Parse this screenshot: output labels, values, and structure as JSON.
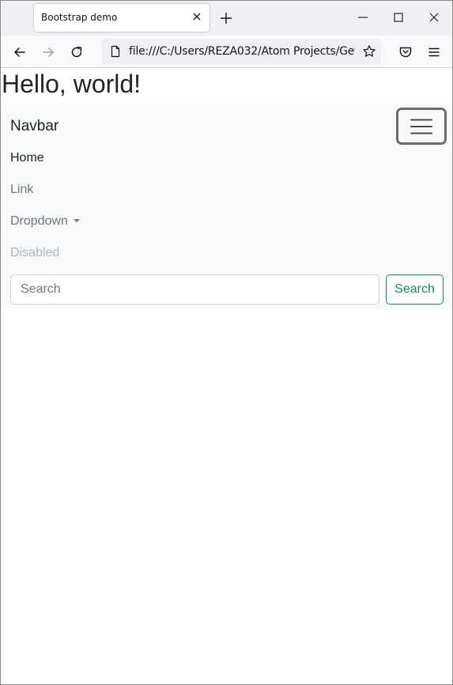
{
  "browser": {
    "tab_title": "Bootstrap demo",
    "url": "file:///C:/Users/REZA032/Atom Projects/Getting",
    "icons": {
      "tab_close": "close-icon",
      "new_tab": "plus-icon",
      "minimize": "minimize-icon",
      "maximize": "maximize-icon",
      "close_window": "close-icon",
      "back": "arrow-left-icon",
      "forward": "arrow-right-icon",
      "reload": "reload-icon",
      "page": "page-icon",
      "bookmark": "star-icon",
      "pocket": "pocket-icon",
      "menu": "hamburger-icon"
    }
  },
  "page": {
    "heading": "Hello, world!",
    "navbar": {
      "brand": "Navbar",
      "toggler_icon": "hamburger-icon",
      "links": {
        "home": "Home",
        "link": "Link",
        "dropdown": "Dropdown",
        "disabled": "Disabled"
      },
      "search": {
        "placeholder": "Search",
        "value": "",
        "button_label": "Search"
      }
    }
  },
  "colors": {
    "navbar_bg": "#f8f9fa",
    "success": "#198754",
    "text": "#212529",
    "muted_link": "#737678",
    "disabled_link": "#b2b5b8"
  }
}
